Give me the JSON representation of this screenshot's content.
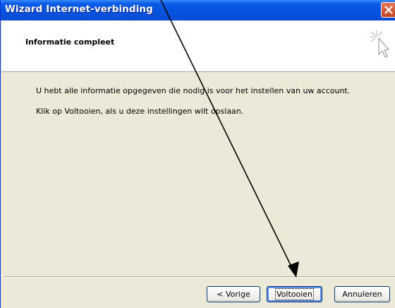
{
  "window": {
    "title": "Wizard Internet-verbinding",
    "close_label": "Sluiten"
  },
  "header": {
    "title": "Informatie compleet",
    "icon": "wizard-wand-icon"
  },
  "content": {
    "line1": "U hebt alle informatie opgegeven die nodig is voor het instellen van uw account.",
    "line2": "Klik op Voltooien, als u deze instellingen wilt opslaan."
  },
  "buttons": {
    "back_label": "< Vorige",
    "finish_label": "Voltooien",
    "cancel_label": "Annuleren"
  },
  "annotation": {
    "type": "arrow",
    "points_to": "finish-button",
    "color": "#000000"
  },
  "colors": {
    "titlebar": "#0553e1",
    "close_button": "#c4401d",
    "dialog_background": "#ece9d8",
    "header_background": "#ffffff"
  }
}
